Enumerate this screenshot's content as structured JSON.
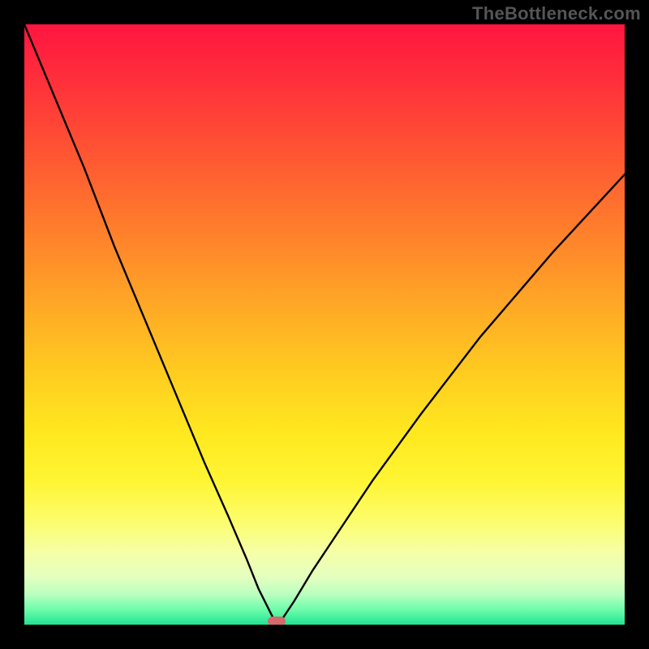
{
  "watermark": "TheBottleneck.com",
  "colors": {
    "page_bg": "#000000",
    "gradient_top": "#ff153f",
    "gradient_mid": "#ffe81f",
    "gradient_bottom": "#20e492",
    "curve": "#000000",
    "indicator": "#d46a6a"
  },
  "chart_data": {
    "type": "line",
    "title": "",
    "xlabel": "",
    "ylabel": "",
    "xlim": [
      0,
      100
    ],
    "ylim": [
      0,
      100
    ],
    "grid": false,
    "legend": false,
    "annotations": [
      {
        "name": "minimum-indicator",
        "x": 42,
        "y": 0
      }
    ],
    "series": [
      {
        "name": "bottleneck-curve",
        "x": [
          0,
          5,
          10,
          15,
          20,
          25,
          30,
          34,
          37,
          39,
          41,
          42,
          43,
          45,
          48,
          52,
          58,
          66,
          76,
          88,
          100
        ],
        "y": [
          100,
          88,
          76,
          63,
          51,
          39,
          27,
          18,
          11,
          6,
          2,
          0,
          1,
          4,
          9,
          15,
          24,
          35,
          48,
          62,
          75
        ]
      }
    ]
  }
}
